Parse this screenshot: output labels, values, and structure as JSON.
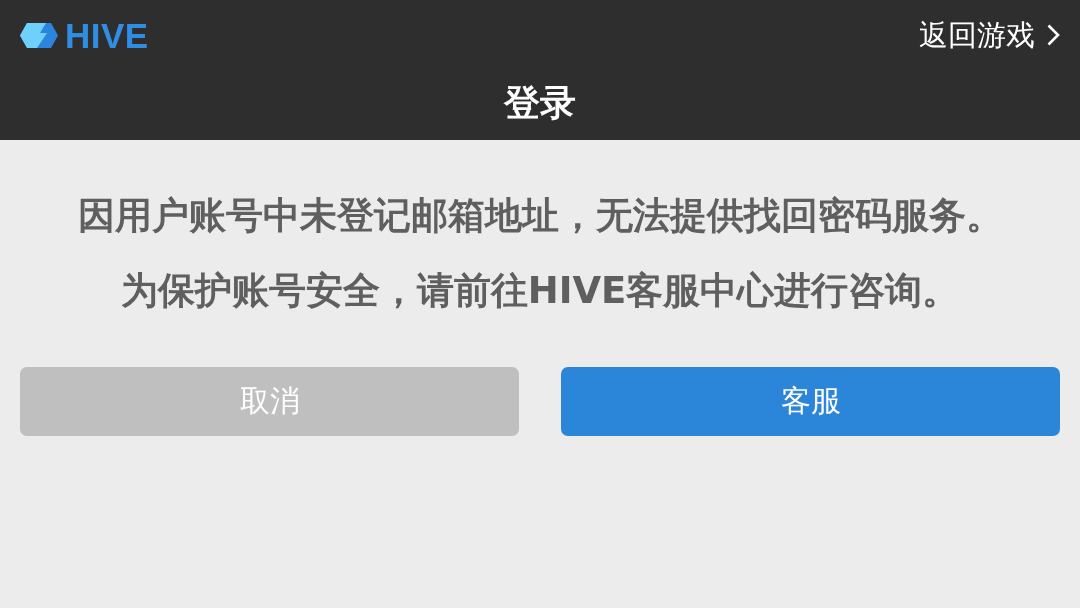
{
  "header": {
    "logo": {
      "text": "HIVE"
    },
    "back_link": {
      "label": "返回游戏"
    },
    "title": "登录"
  },
  "message": {
    "lines": [
      "因用户账号中未登记邮箱地址，无法提供找回密码服务。",
      "为保护账号安全，请前往HIVE客服中心进行咨询。"
    ]
  },
  "buttons": [
    {
      "label": "取消",
      "kind": "secondary"
    },
    {
      "label": "客服",
      "kind": "primary"
    }
  ]
}
